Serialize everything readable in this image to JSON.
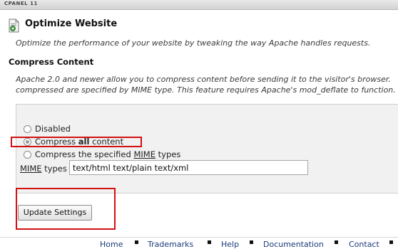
{
  "topbar": {
    "label": "CPANEL 11"
  },
  "page": {
    "title": "Optimize Website",
    "subtitle": "Optimize the performance of your website by tweaking the way Apache handles requests.",
    "icon": "document-gear-icon"
  },
  "compress": {
    "heading": "Compress Content",
    "description_line1": "Apache 2.0 and newer allow you to compress content before sending it to the visitor's browser.",
    "description_line2": "compressed are specified by MIME type. This feature requires Apache's mod_deflate to function.",
    "options": {
      "disabled": "Disabled",
      "all_prefix": "Compress ",
      "all_bold": "all",
      "all_suffix": " content",
      "specified_prefix": "Compress the specified ",
      "specified_mime": "MIME",
      "specified_suffix": " types"
    },
    "selected_option": "all",
    "mime_label_prefix": "MIME",
    "mime_label_suffix": " types",
    "mime_value": "text/html text/plain text/xml",
    "submit_label": "Update Settings"
  },
  "highlight_color": "#d31010",
  "footer": {
    "links": [
      "Home",
      "Trademarks",
      "Help",
      "Documentation",
      "Contact"
    ]
  }
}
